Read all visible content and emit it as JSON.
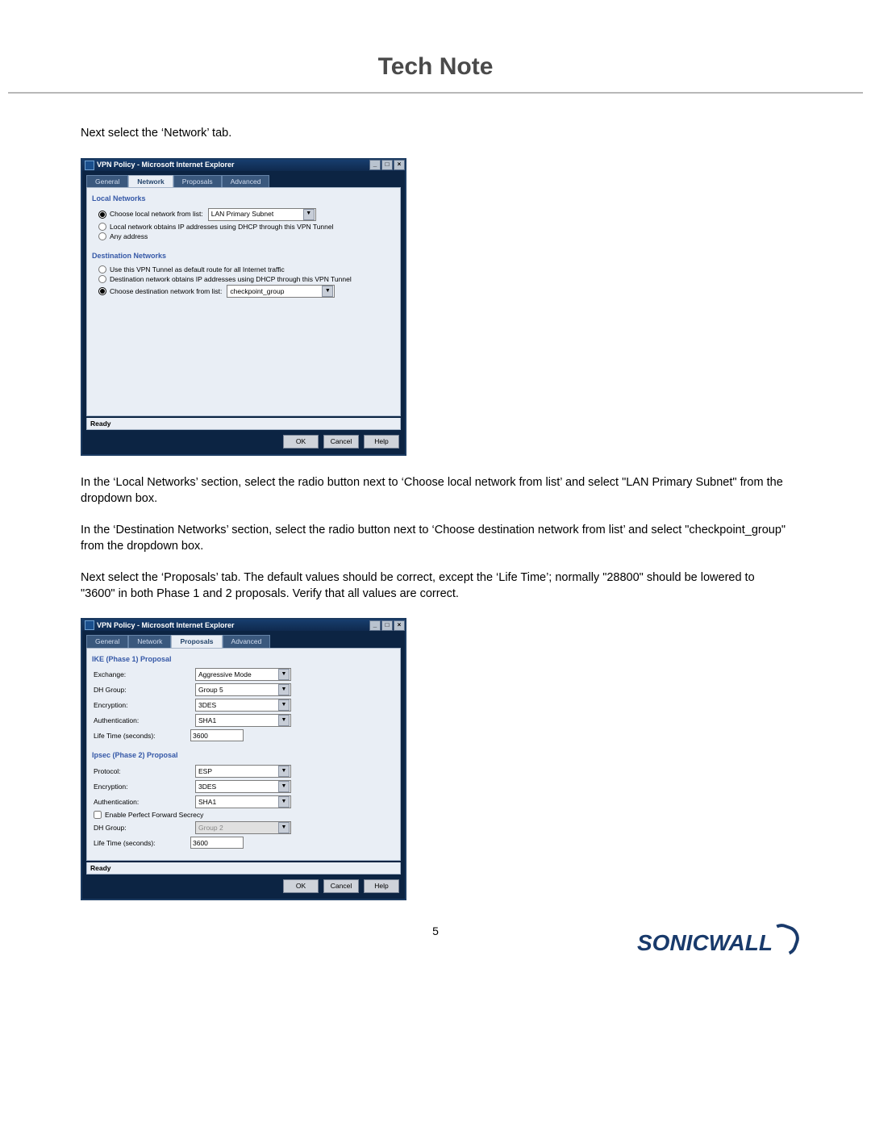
{
  "header_title": "Tech Note",
  "para1": "Next select the ‘Network’ tab.",
  "para2": "In the ‘Local Networks’ section, select the radio button next to ‘Choose local network from list’ and select \"LAN Primary Subnet\" from the dropdown box.",
  "para3": "In the ‘Destination Networks’ section, select the radio button next to ‘Choose destination network from list’ and select \"checkpoint_group\" from the dropdown box.",
  "para4": "Next select the ‘Proposals’ tab. The default values should be correct, except the ‘Life Time’; normally \"28800\" should be lowered to \"3600\" in both Phase 1 and 2 proposals. Verify that all values are correct.",
  "window_title": "VPN Policy - Microsoft Internet Explorer",
  "winbtns": {
    "min": "_",
    "max": "□",
    "close": "×"
  },
  "tabs": {
    "general": "General",
    "network": "Network",
    "proposals": "Proposals",
    "advanced": "Advanced"
  },
  "network_tab": {
    "local_networks_title": "Local Networks",
    "choose_local_label": "Choose local network from list:",
    "choose_local_value": "LAN Primary Subnet",
    "local_dhcp_label": "Local network obtains IP addresses using DHCP through this VPN Tunnel",
    "any_address_label": "Any address",
    "dest_networks_title": "Destination Networks",
    "default_route_label": "Use this VPN Tunnel as default route for all Internet traffic",
    "dest_dhcp_label": "Destination network obtains IP addresses using DHCP through this VPN Tunnel",
    "choose_dest_label": "Choose destination network from list:",
    "choose_dest_value": "checkpoint_group"
  },
  "proposals_tab": {
    "phase1_title": "IKE (Phase 1) Proposal",
    "exchange_label": "Exchange:",
    "exchange_value": "Aggressive Mode",
    "dhgroup_label": "DH Group:",
    "dhgroup_value": "Group 5",
    "encryption_label": "Encryption:",
    "encryption_value": "3DES",
    "auth_label": "Authentication:",
    "auth_value": "SHA1",
    "lifetime_label": "Life Time (seconds):",
    "lifetime_value": "3600",
    "phase2_title": "Ipsec (Phase 2) Proposal",
    "protocol_label": "Protocol:",
    "protocol_value": "ESP",
    "encryption2_value": "3DES",
    "auth2_value": "SHA1",
    "pfs_label": "Enable Perfect Forward Secrecy",
    "dhgroup2_value": "Group 2",
    "lifetime2_value": "3600"
  },
  "status_text": "Ready",
  "buttons": {
    "ok": "OK",
    "cancel": "Cancel",
    "help": "Help"
  },
  "page_number": "5",
  "logo_text": "SONICWALL"
}
